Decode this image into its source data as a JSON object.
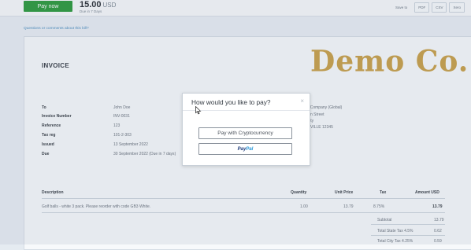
{
  "topbar": {
    "pay_now": "Pay now",
    "amount": "15.00",
    "currency": "USD",
    "due": "Due in 7 Days",
    "save_to": "Save to",
    "buttons": [
      "PDF",
      "CSV",
      "Xero"
    ]
  },
  "questions_link": "Questions or comments about this bill?",
  "invoice": {
    "title": "INVOICE",
    "logo": "Demo Co.",
    "fields": [
      {
        "label": "To",
        "value": "John Doe"
      },
      {
        "label": "Invoice Number",
        "value": "INV-0031"
      },
      {
        "label": "Reference",
        "value": "123"
      },
      {
        "label": "Tax reg",
        "value": "101-2-303"
      },
      {
        "label": "Issued",
        "value": "13 September 2022"
      },
      {
        "label": "Due",
        "value": "30 September 2022",
        "extra": "Due in 7 days"
      }
    ],
    "address": [
      "Demo Company (Global)",
      "23 Main Street",
      "Oak City",
      "BAINEVILLE 12345"
    ],
    "table": {
      "headers": [
        "Description",
        "Quantity",
        "Unit Price",
        "Tax",
        "Amount USD"
      ],
      "rows": [
        {
          "description": "Golf balls - white 3 pack. Please reorder with code GB3 White.",
          "quantity": "1.00",
          "unit_price": "13.79",
          "tax": "8.75%",
          "amount": "13.79"
        }
      ],
      "totals": [
        {
          "label": "Subtotal",
          "value": "13.79"
        },
        {
          "label": "Total State Tax 4.5%",
          "value": "0.62"
        },
        {
          "label": "Total City Tax 4.25%",
          "value": "0.59"
        }
      ]
    }
  },
  "modal": {
    "title": "How would you like to pay?",
    "close": "×",
    "crypto_label": "Pay with Cryptocurrency",
    "paypal_pay": "Pay",
    "paypal_pal": "Pal"
  }
}
